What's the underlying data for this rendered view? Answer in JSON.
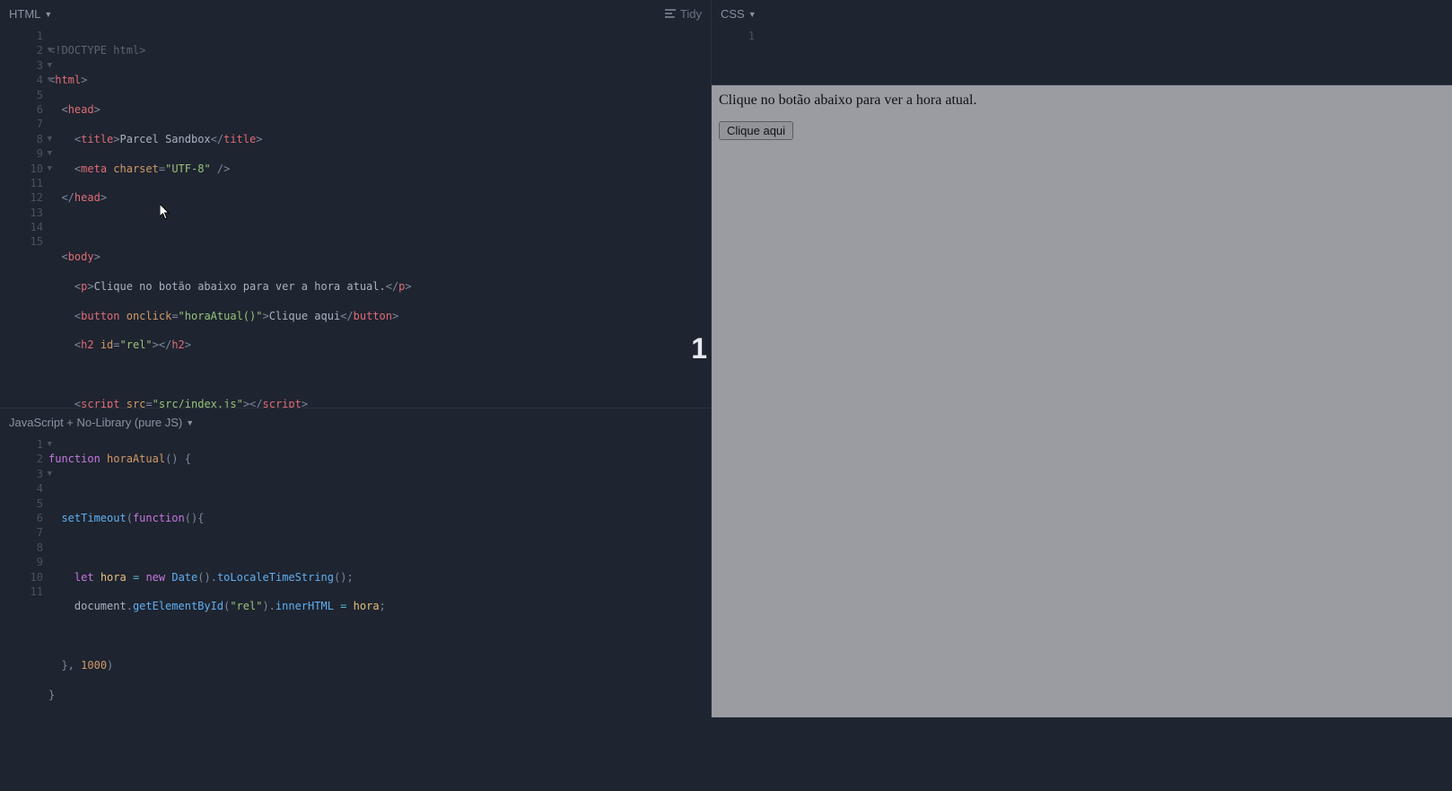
{
  "panels": {
    "html": {
      "label": "HTML",
      "tidy": "Tidy"
    },
    "js": {
      "label": "JavaScript + No-Library (pure JS)"
    },
    "css": {
      "label": "CSS"
    }
  },
  "html_code": {
    "l1": {
      "num": "1"
    },
    "l2": {
      "num": "2"
    },
    "l3": {
      "num": "3"
    },
    "l4": {
      "num": "4",
      "title_text": "Parcel Sandbox"
    },
    "l5": {
      "num": "5",
      "charset": "\"UTF-8\""
    },
    "l6": {
      "num": "6"
    },
    "l7": {
      "num": "7"
    },
    "l8": {
      "num": "8"
    },
    "l9": {
      "num": "9",
      "p_text": "Clique no botão abaixo para ver a hora atual."
    },
    "l10": {
      "num": "10",
      "onclick": "\"horaAtual()\"",
      "btn_text": "Clique aqui"
    },
    "l11": {
      "num": "11",
      "id": "\"rel\""
    },
    "l12": {
      "num": "12"
    },
    "l13": {
      "num": "13",
      "src": "\"src/index.js\""
    },
    "l14": {
      "num": "14"
    },
    "l15": {
      "num": "15"
    }
  },
  "js_code": {
    "l1": {
      "num": "1",
      "kw_function": "function",
      "fn": "horaAtual"
    },
    "l2": {
      "num": "2"
    },
    "l3": {
      "num": "3",
      "set": "setTimeout",
      "kw_function": "function"
    },
    "l4": {
      "num": "4"
    },
    "l5": {
      "num": "5",
      "let": "let",
      "var": "hora",
      "new": "new",
      "date": "Date",
      "tls": "toLocaleTimeString"
    },
    "l6": {
      "num": "6",
      "doc": "document",
      "gebi": "getElementById",
      "arg": "\"rel\"",
      "inner": "innerHTML",
      "var": "hora"
    },
    "l7": {
      "num": "7"
    },
    "l8": {
      "num": "8",
      "delay": "1000"
    },
    "l9": {
      "num": "9"
    },
    "l10": {
      "num": "10"
    },
    "l11": {
      "num": "11"
    }
  },
  "css_code": {
    "l1": {
      "num": "1"
    }
  },
  "preview": {
    "paragraph": "Clique no botão abaixo para ver a hora atual.",
    "button": "Clique aqui"
  },
  "badge": "1"
}
